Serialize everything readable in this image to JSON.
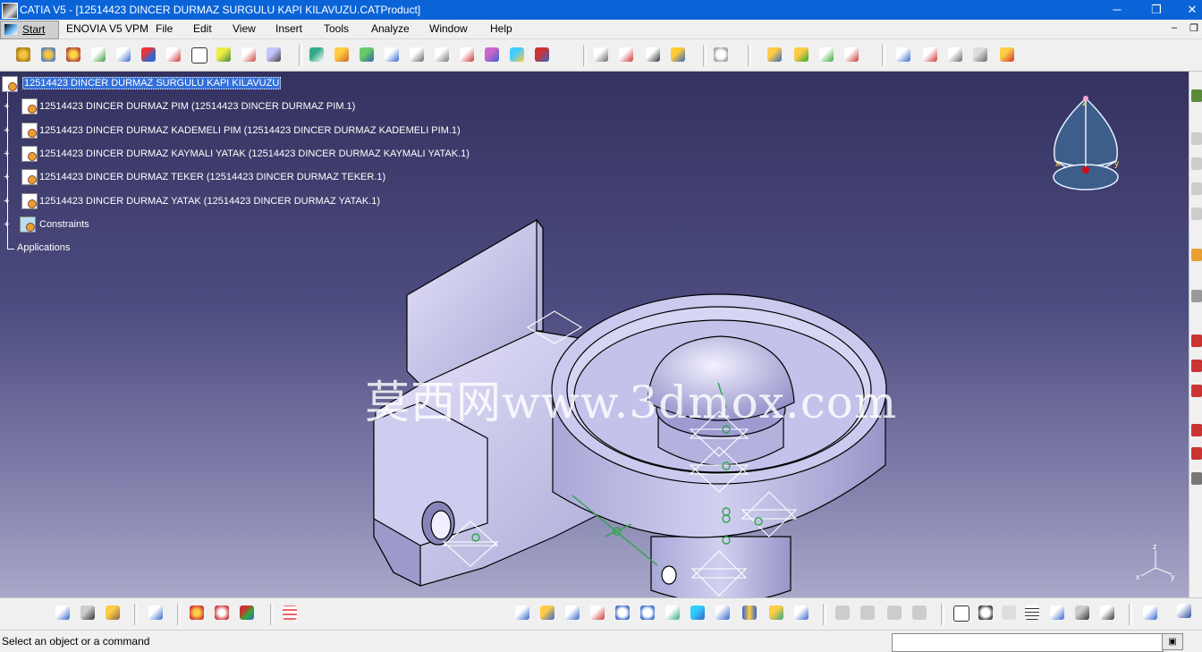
{
  "window": {
    "title": "CATIA V5 - [12514423 DINCER DURMAZ SURGULU KAPI KILAVUZU.CATProduct]",
    "minimize": "─",
    "restore": "❐",
    "close": "✕"
  },
  "menu": {
    "start": "Start",
    "items": [
      "ENOVIA V5 VPM",
      "File",
      "Edit",
      "View",
      "Insert",
      "Tools",
      "Analyze",
      "Window",
      "Help"
    ],
    "mdi_minimize": "–",
    "mdi_restore": "❐"
  },
  "tree": {
    "root": "12514423 DINCER DURMAZ SURGULU KAPI KILAVUZU",
    "children": [
      "12514423 DINCER DURMAZ  PIM (12514423 DINCER DURMAZ  PIM.1)",
      "12514423 DINCER DURMAZ KADEMELI PIM (12514423 DINCER DURMAZ KADEMELI PIM.1)",
      "12514423 DINCER DURMAZ KAYMALI YATAK (12514423 DINCER DURMAZ KAYMALI YATAK.1)",
      "12514423 DINCER DURMAZ TEKER (12514423 DINCER DURMAZ TEKER.1)",
      "12514423 DINCER DURMAZ YATAK (12514423 DINCER DURMAZ YATAK.1)"
    ],
    "constraints": "Constraints",
    "applications": "Applications"
  },
  "viewport": {
    "watermark": "莫西网www.3dmox.com",
    "compass_labels": {
      "x": "x",
      "y": "y",
      "z": "z"
    },
    "axis_labels": {
      "x": "x",
      "y": "y",
      "z": "z"
    }
  },
  "status": {
    "message": "Select an object or a command",
    "command_value": ""
  },
  "colors": {
    "titlebar": "#0a64d8",
    "part": "#c8c6ec",
    "viewport_top": "#34325f",
    "viewport_bottom": "#a9a8c9"
  }
}
